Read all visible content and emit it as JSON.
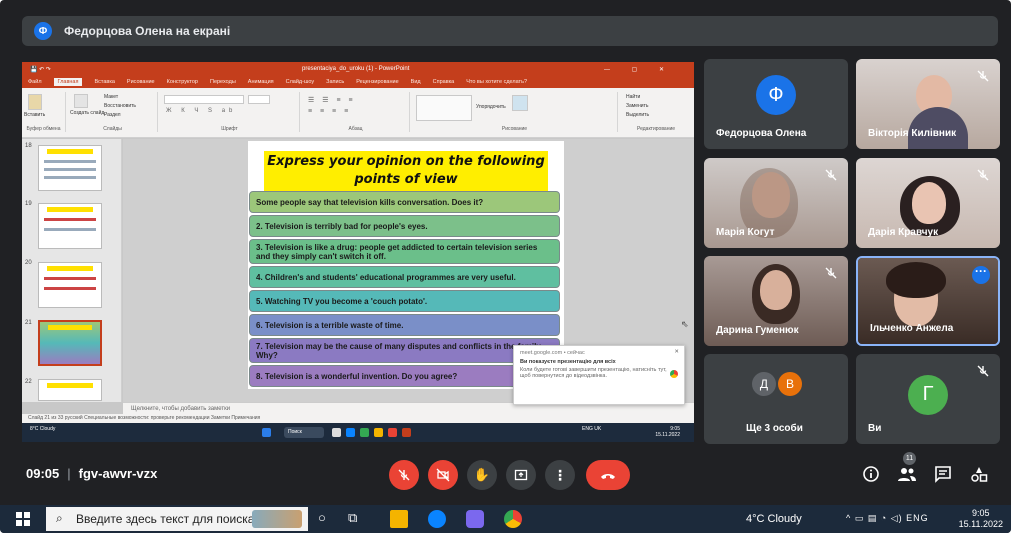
{
  "presenter": {
    "avatar_letter": "Ф",
    "banner": "Федорцова Олена на екрані"
  },
  "powerpoint": {
    "title": "presentaciya_do_uroku (1) - PowerPoint",
    "tabs": [
      "Файл",
      "Главная",
      "Вставка",
      "Рисование",
      "Конструктор",
      "Переходы",
      "Анимация",
      "Слайд-шоу",
      "Запись",
      "Рецензирование",
      "Вид",
      "Справка",
      "Что вы хотите сделать?"
    ],
    "ribbon_groups": [
      "Буфер обмена",
      "Слайды",
      "Шрифт",
      "Абзац",
      "Рисование",
      "Редактирование"
    ],
    "ribbon_buttons": {
      "paste": "Вставить",
      "new_slide": "Создать слайд",
      "layout": "Макет",
      "reset": "Восстановить",
      "section": "Раздел",
      "arrange": "Упорядочить",
      "find": "Найти",
      "replace": "Заменить",
      "select": "Выделить"
    },
    "slide_numbers": [
      "18",
      "19",
      "20",
      "21",
      "22"
    ],
    "slide": {
      "title": "Express your opinion on the following points of view",
      "statements": [
        "Some people say that television kills conversation.  Does it?",
        "2. Television is terribly bad for people's eyes.",
        "3. Television is like a drug: people get addicted to certain television series and  they simply can't switch it off.",
        "4. Children's and students' educational programmes are very useful.",
        "5. Watching TV you become a 'couch potato'.",
        "6. Television is a terrible waste of time.",
        "7. Television may be the cause of many disputes and conflicts in the family. Why?",
        "8. Television is a wonderful invention. Do you agree?"
      ],
      "colors": [
        "#9cc77a",
        "#7cc08a",
        "#6bbf8a",
        "#5fbfa0",
        "#55b9b8",
        "#7a8fc8",
        "#8b7ac2",
        "#9b7cc0"
      ]
    },
    "notes_placeholder": "Щелкните, чтобы добавить заметки",
    "status": "Слайд 21 из 33   русский   Специальные возможности: проверьте рекомендации   Заметки   Примечания",
    "inner_taskbar": {
      "weather": "8°C Cloudy",
      "search": "Поиск",
      "lang": "ENG UK",
      "time": "9:05",
      "date": "15.11.2022"
    },
    "toast": {
      "source": "meet.google.com • сейчас",
      "title": "Ви показуєте презентацію для всіх",
      "body": "Коли будете готові завершити презентацію, натисніть тут, щоб повернутися до відеодзвінка."
    }
  },
  "participants": [
    {
      "name": "Федорцова Олена",
      "type": "avatar",
      "letter": "Ф",
      "color": "#1a73e8"
    },
    {
      "name": "Вікторія Килівник",
      "type": "video",
      "muted": true
    },
    {
      "name": "Марія Когут",
      "type": "video",
      "muted": true
    },
    {
      "name": "Дарія Кравчук",
      "type": "video",
      "muted": true
    },
    {
      "name": "Дарина Гуменюк",
      "type": "video",
      "muted": true
    },
    {
      "name": "Ільченко Анжела",
      "type": "video",
      "muted": false
    },
    {
      "name": "Ще 3 особи",
      "type": "group",
      "letters": [
        "Д",
        "В"
      ]
    },
    {
      "name": "Ви",
      "type": "avatar",
      "letter": "Г",
      "color": "#4caf50",
      "muted": true
    }
  ],
  "meeting": {
    "time": "09:05",
    "separator": "|",
    "code": "fgv-awvr-vzx",
    "participant_count": "11"
  },
  "taskbar": {
    "search_placeholder": "Введите здесь текст для поиска",
    "weather": "4°C  Cloudy",
    "lang": "ENG",
    "time": "9:05",
    "date": "15.11.2022"
  }
}
